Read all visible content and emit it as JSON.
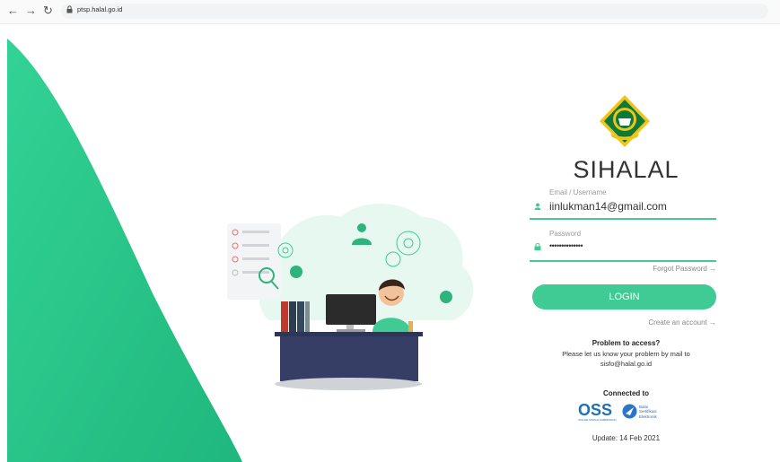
{
  "browser": {
    "back_icon": "arrow-left-icon",
    "forward_icon": "arrow-right-icon",
    "reload_icon": "reload-icon",
    "lock_icon": "lock-icon",
    "url": "ptsp.halal.go.id"
  },
  "illustration": {
    "description_icons": [
      "checklist-icon",
      "gear-icon",
      "user-icon",
      "magnifier-icon",
      "computer-icon",
      "folders-icon",
      "person-at-desk"
    ]
  },
  "login": {
    "logo_icon": "kemenag-emblem",
    "title": "SIHALAL",
    "email_label": "Email / Username",
    "email_value": "iinlukman14@gmail.com",
    "password_label": "Password",
    "password_value": "••••••••••••••",
    "forgot_password": "Forgot Password →",
    "login_button": "LOGIN",
    "create_account": "Create an account →"
  },
  "help": {
    "title": "Problem to access?",
    "text_line1": "Please let us know your problem by mail to",
    "text_line2": "sisfo@halal.go.id"
  },
  "connected": {
    "title": "Connected to",
    "oss_label": "OSS",
    "oss_sub": "ONLINE SINGLE SUBMISSION",
    "bse_line1": "Balai",
    "bse_line2": "Sertifikasi",
    "bse_line3": "Elektronik"
  },
  "update": "Update: 14 Feb 2021",
  "colors": {
    "accent": "#3fcb93",
    "accent_line": "#46c996",
    "oss_blue": "#1f6fb5"
  }
}
